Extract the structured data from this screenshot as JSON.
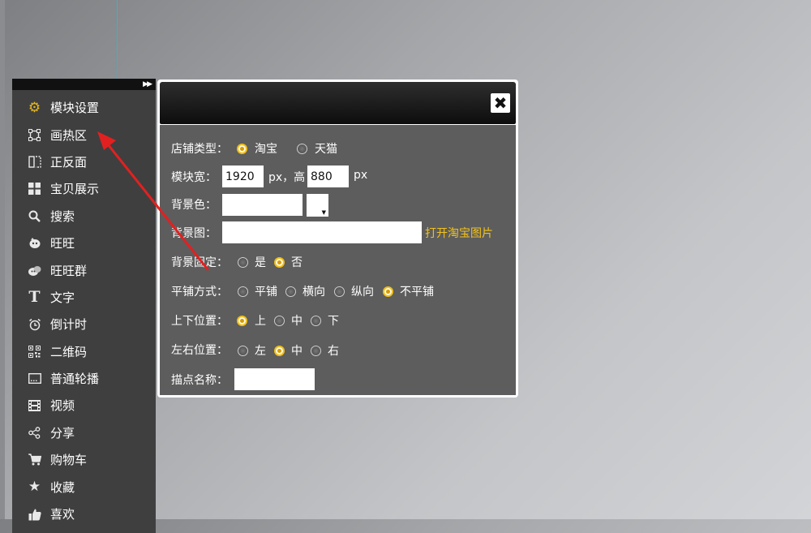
{
  "sidebar": {
    "collapse_icon": "double-chevron-right-icon",
    "items": [
      {
        "label": "模块设置",
        "icon": "gear-icon"
      },
      {
        "label": "画热区",
        "icon": "hotspot-icon"
      },
      {
        "label": "正反面",
        "icon": "flip-icon"
      },
      {
        "label": "宝贝展示",
        "icon": "grid-icon"
      },
      {
        "label": "搜索",
        "icon": "search-icon"
      },
      {
        "label": "旺旺",
        "icon": "wangwang-icon"
      },
      {
        "label": "旺旺群",
        "icon": "wangwang-group-icon"
      },
      {
        "label": "文字",
        "icon": "text-icon"
      },
      {
        "label": "倒计时",
        "icon": "alarm-clock-icon"
      },
      {
        "label": "二维码",
        "icon": "qrcode-icon"
      },
      {
        "label": "普通轮播",
        "icon": "carousel-icon"
      },
      {
        "label": "视频",
        "icon": "video-icon"
      },
      {
        "label": "分享",
        "icon": "share-icon"
      },
      {
        "label": "购物车",
        "icon": "cart-icon"
      },
      {
        "label": "收藏",
        "icon": "star-icon"
      },
      {
        "label": "喜欢",
        "icon": "thumbs-up-icon"
      }
    ]
  },
  "dialog": {
    "close_icon": "close-icon",
    "shop_type": {
      "label": "店铺类型：",
      "options": [
        "淘宝",
        "天猫"
      ],
      "selected": "淘宝"
    },
    "module_width": {
      "label": "模块宽：",
      "width": "1920",
      "unit1": "px，高",
      "height": "880",
      "unit2": "px"
    },
    "bg_color": {
      "label": "背景色：",
      "value": ""
    },
    "bg_image": {
      "label": "背景图：",
      "value": "",
      "link": "打开淘宝图片"
    },
    "bg_fixed": {
      "label": "背景固定：",
      "options": [
        "是",
        "否"
      ],
      "selected": "否"
    },
    "tile_mode": {
      "label": "平铺方式：",
      "options": [
        "平铺",
        "横向",
        "纵向",
        "不平铺"
      ],
      "selected": "不平铺"
    },
    "v_position": {
      "label": "上下位置：",
      "options": [
        "上",
        "中",
        "下"
      ],
      "selected": "上"
    },
    "h_position": {
      "label": "左右位置：",
      "options": [
        "左",
        "中",
        "右"
      ],
      "selected": "中"
    },
    "anchor_name": {
      "label": "描点名称：",
      "value": ""
    }
  },
  "annotation": {
    "arrow_color": "#e32020"
  },
  "colors": {
    "accent": "#f2c21b",
    "sidebar_bg": "#3f3f3f",
    "dialog_bg": "#5d5d5d"
  }
}
